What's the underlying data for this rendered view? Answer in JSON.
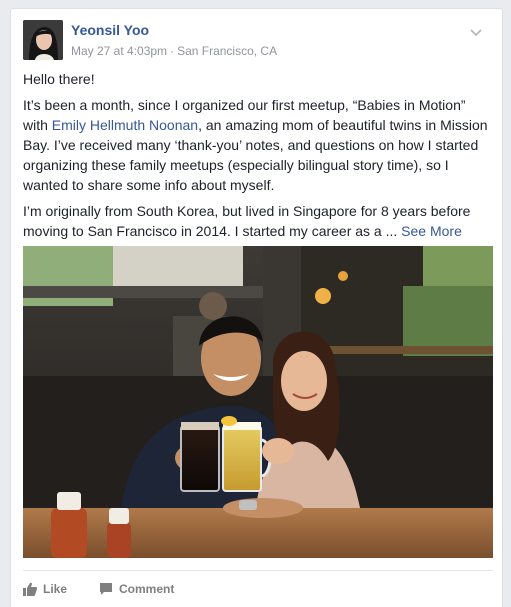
{
  "post": {
    "author": "Yeonsil Yoo",
    "date": "May 27 at 4:03pm",
    "separator": "·",
    "location": "San Francisco, CA",
    "greeting": "Hello there!",
    "p2_a": "It’s been a month, since I organized our first meetup, “Babies in Motion” with ",
    "p2_link": "Emily Hellmuth Noonan",
    "p2_b": ", an amazing mom of beautiful twins in Mission Bay. I’ve received many ‘thank-you’ notes, and questions on how I started organizing these family meetups (especially bilingual story time), so I wanted to share some info about myself.",
    "p3_a": "I’m originally from South Korea, but lived in Singapore for 8 years before moving to San Francisco in 2014. I started my career as a ... ",
    "see_more": "See More"
  },
  "actions": {
    "like": "Like",
    "comment": "Comment"
  },
  "icons": {
    "menu": "chevron-down-icon",
    "like": "thumbs-up-icon",
    "comment": "speech-bubble-icon"
  },
  "colors": {
    "link": "#365899",
    "meta": "#90949c",
    "text": "#1d2129",
    "action": "#7f7f7f"
  }
}
